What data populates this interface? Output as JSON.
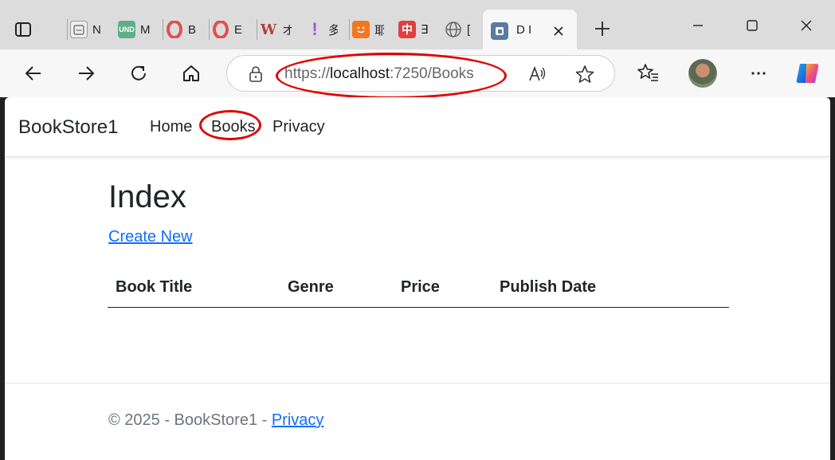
{
  "tabs": [
    {
      "title": "N",
      "icon": "calendar-icon",
      "color": "#7a7a7a"
    },
    {
      "title": "M",
      "icon": "und-icon",
      "color": "#5fae8a"
    },
    {
      "title": "B",
      "icon": "opera-icon",
      "color": "#e05050"
    },
    {
      "title": "E",
      "icon": "opera-icon",
      "color": "#e05050"
    },
    {
      "title": "オ",
      "icon": "w-icon",
      "color": "#b04040"
    },
    {
      "title": "多",
      "icon": "exclaim-icon",
      "color": "#9a5ad0"
    },
    {
      "title": "耶",
      "icon": "plug-icon",
      "color": "#f07820"
    },
    {
      "title": "∃",
      "icon": "zhong-icon",
      "color": "#e04040"
    },
    {
      "title": "[",
      "icon": "globe-icon",
      "color": "#666666"
    }
  ],
  "active_tab": {
    "title": "D I",
    "icon": "edge-doc-icon",
    "color": "#5a7aa0"
  },
  "address_bar": {
    "scheme": "https://",
    "host": "localhost",
    "rest": ":7250/Books"
  },
  "page": {
    "brand": "BookStore1",
    "nav": [
      "Home",
      "Books",
      "Privacy"
    ],
    "heading": "Index",
    "create_link": "Create New",
    "table_headers": [
      "Book Title",
      "Genre",
      "Price",
      "Publish Date"
    ],
    "footer_text": "© 2025 - BookStore1 - ",
    "footer_link": "Privacy"
  },
  "colors": {
    "annotation": "#e00000",
    "link": "#0d6efd"
  }
}
